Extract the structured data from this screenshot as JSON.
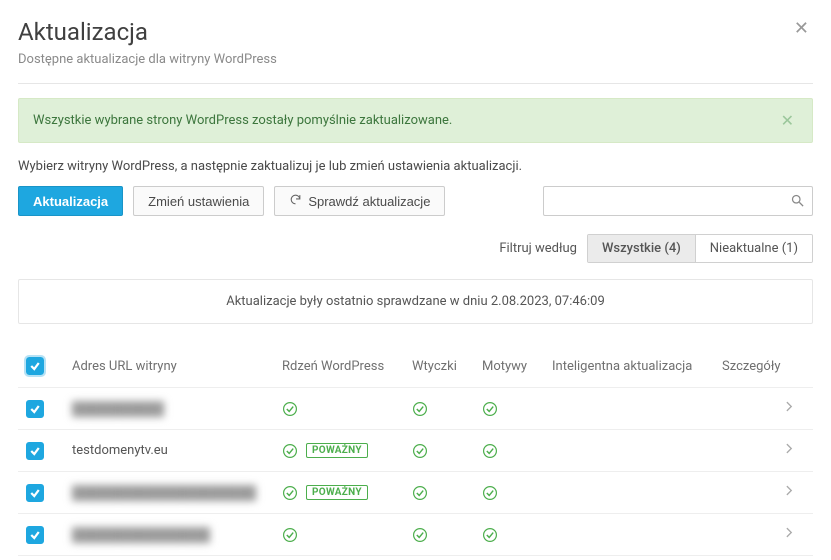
{
  "header": {
    "title": "Aktualizacja",
    "subtitle": "Dostępne aktualizacje dla witryny WordPress"
  },
  "alert": {
    "text": "Wszystkie wybrane strony WordPress zostały pomyślnie zaktualizowane."
  },
  "instruction": "Wybierz witryny WordPress, a następnie zaktualizuj je lub zmień ustawienia aktualizacji.",
  "toolbar": {
    "update_label": "Aktualizacja",
    "settings_label": "Zmień ustawienia",
    "check_label": "Sprawdź aktualizacje",
    "search_placeholder": ""
  },
  "filter": {
    "label": "Filtruj według",
    "all": "Wszystkie (4)",
    "outdated": "Nieaktualne (1)"
  },
  "last_checked": "Aktualizacje były ostatnio sprawdzane w dniu 2.08.2023, 07:46:09",
  "columns": {
    "url": "Adres URL witryny",
    "core": "Rdzeń WordPress",
    "plugins": "Wtyczki",
    "themes": "Motywy",
    "smart": "Inteligentna aktualizacja",
    "details": "Szczegóły"
  },
  "rows": [
    {
      "url": "██████████",
      "blur": true,
      "core_badge": null,
      "checked": true
    },
    {
      "url": "testdomenytv.eu",
      "blur": false,
      "core_badge": "POWAŻNY",
      "checked": true
    },
    {
      "url": "████████████████████",
      "blur": true,
      "core_badge": "POWAŻNY",
      "checked": true
    },
    {
      "url": "███████████████",
      "blur": true,
      "core_badge": null,
      "checked": true
    }
  ],
  "icons": {
    "check": "ok",
    "refresh": "refresh",
    "search": "search"
  },
  "colors": {
    "primary": "#1ea7e0",
    "success": "#4cae4c",
    "alert_bg": "#dff0d8"
  }
}
